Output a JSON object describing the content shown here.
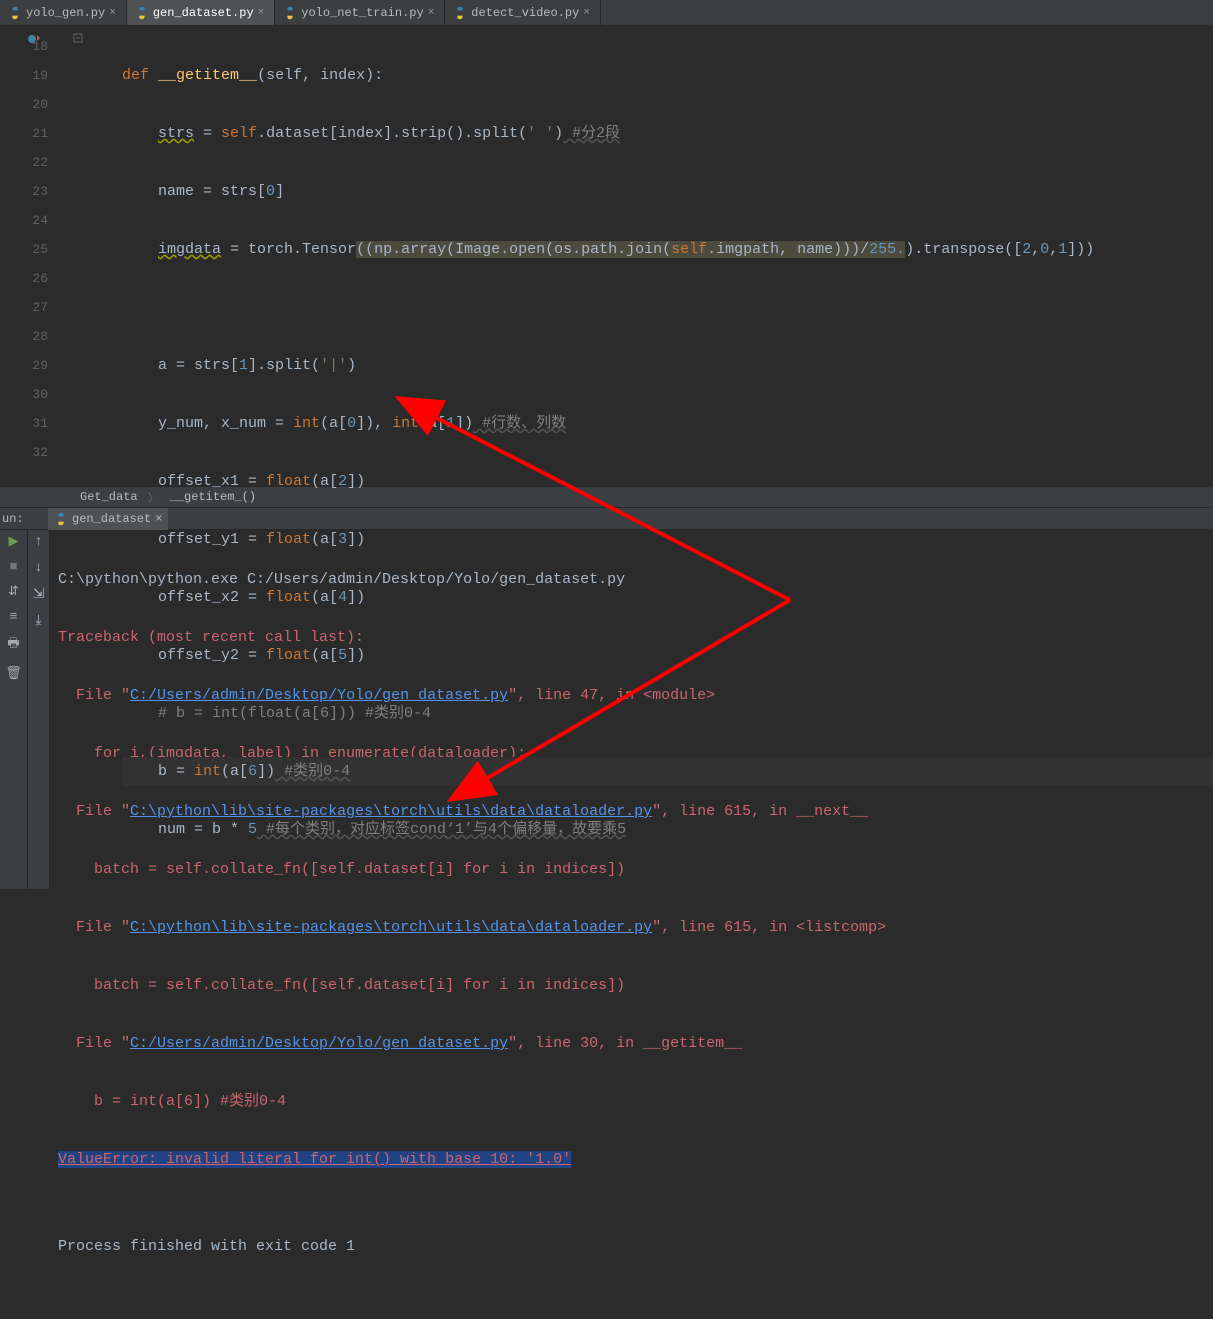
{
  "tabs": [
    {
      "label": "yolo_gen.py",
      "active": false
    },
    {
      "label": "gen_dataset.py",
      "active": true
    },
    {
      "label": "yolo_net_train.py",
      "active": false
    },
    {
      "label": "detect_video.py",
      "active": false
    }
  ],
  "gutter": {
    "start": 18,
    "end": 32
  },
  "breadcrumb": {
    "a": "Get_data",
    "b": "__getitem_()"
  },
  "run": {
    "panel_label": "un:",
    "config": "gen_dataset"
  },
  "code": {
    "l18": {
      "def": "def",
      "name": "__getitem__",
      "params": "(self, index):"
    },
    "l19": {
      "lhs": "strs",
      "eq": " = ",
      "self": "self",
      "rest": ".dataset[index].strip().split(",
      "str": "' '",
      "rest2": ")",
      "cmt": " #分2段"
    },
    "l20": {
      "txt": "name = strs[",
      "n": "0",
      "r": "]"
    },
    "l21": {
      "lhs": "imgdata",
      "eq": " = torch.Tensor",
      "p1": "((np.array(Image.open(os.path.join(",
      "self": "self",
      "p2": ".imgpath, name)))/",
      "n1": "255.",
      "p3": ").transpose([",
      "n2": "2",
      "c1": ",",
      "n3": "0",
      "c2": ",",
      "n4": "1",
      "p4": "]))"
    },
    "l22": "",
    "l23": {
      "lhs": "a = strs[",
      "n": "1",
      "r": "].split(",
      "s": "'|'",
      "e": ")"
    },
    "l24": {
      "a": "y_num, x_num = ",
      "int": "int",
      "b": "(a[",
      "n0": "0",
      "c": "]), ",
      "int2": "int",
      "d": "(a[",
      "n1": "1",
      "e": "])",
      "cmt": " #行数、列数"
    },
    "l25": {
      "a": "offset_x1 = ",
      "fl": "float",
      "b": "(a[",
      "n": "2",
      "c": "])"
    },
    "l26": {
      "a": "offset_y1 = ",
      "fl": "float",
      "b": "(a[",
      "n": "3",
      "c": "])"
    },
    "l27": {
      "a": "offset_x2 = ",
      "fl": "float",
      "b": "(a[",
      "n": "4",
      "c": "])"
    },
    "l28": {
      "a": "offset_y2 = ",
      "fl": "float",
      "b": "(a[",
      "n": "5",
      "c": "])"
    },
    "l29": {
      "cmt": "# b = int(float(a[6])) #类别0-4"
    },
    "l30": {
      "a": "b = ",
      "int": "int",
      "b": "(a[",
      "n": "6",
      "c": "])",
      "cmt": " #类别0-4"
    },
    "l31": {
      "a": "num = b * ",
      "n": "5",
      "cmt": " #每个类别，对应标签cond‘1’与4个偏移量，故要乘5"
    }
  },
  "console": {
    "l1": "C:\\python\\python.exe C:/Users/admin/Desktop/Yolo/gen_dataset.py",
    "l2": "Traceback (most recent call last):",
    "l3a": "  File \"",
    "l3link": "C:/Users/admin/Desktop/Yolo/gen_dataset.py",
    "l3b": "\", line 47, in <module>",
    "l4": "    for i,(imgdata, label) in enumerate(dataloader):",
    "l5a": "  File \"",
    "l5link": "C:\\python\\lib\\site-packages\\torch\\utils\\data\\dataloader.py",
    "l5b": "\", line 615, in __next__",
    "l6": "    batch = self.collate_fn([self.dataset[i] for i in indices])",
    "l7a": "  File \"",
    "l7link": "C:\\python\\lib\\site-packages\\torch\\utils\\data\\dataloader.py",
    "l7b": "\", line 615, in <listcomp>",
    "l8": "    batch = self.collate_fn([self.dataset[i] for i in indices])",
    "l9a": "  File \"",
    "l9link": "C:/Users/admin/Desktop/Yolo/gen_dataset.py",
    "l9b": "\", line 30, in __getitem__",
    "l10": "    b = int(a[6]) #类别0-4",
    "l11": "ValueError: invalid literal for int() with base 10: '1.0'",
    "l12": "",
    "l13": "Process finished with exit code 1"
  }
}
